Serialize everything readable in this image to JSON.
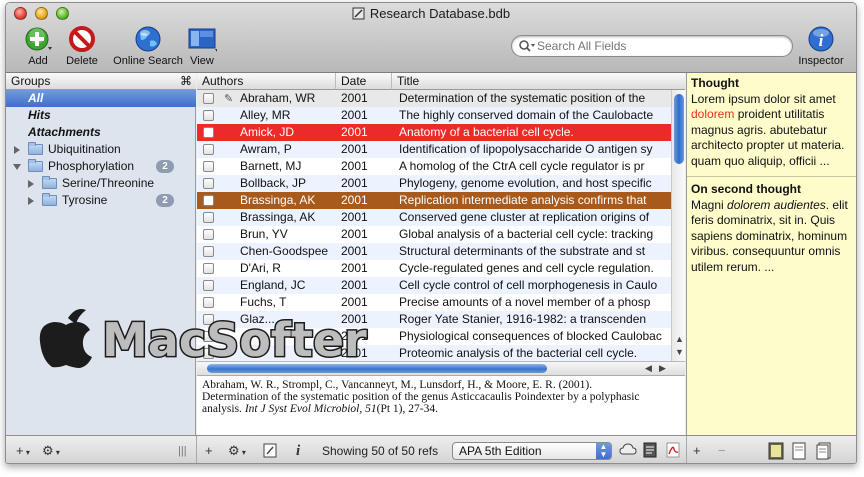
{
  "window": {
    "title": "Research Database.bdb"
  },
  "toolbar": {
    "add_label": "Add",
    "delete_label": "Delete",
    "online_search_label": "Online Search",
    "view_label": "View",
    "inspector_label": "Inspector",
    "search_placeholder": "Search All Fields"
  },
  "groups": {
    "header": "Groups",
    "header_symbol": "⌘",
    "items": [
      {
        "label": "All"
      },
      {
        "label": "Hits"
      },
      {
        "label": "Attachments"
      },
      {
        "label": "Ubiquitination"
      },
      {
        "label": "Phosphorylation",
        "count": "2"
      },
      {
        "label": "Serine/Threonine"
      },
      {
        "label": "Tyrosine",
        "count": "2"
      }
    ]
  },
  "table": {
    "columns": {
      "authors": "Authors",
      "date": "Date",
      "title": "Title"
    },
    "rows": [
      {
        "author": "Abraham, WR",
        "year": "2001",
        "title": "Determination of the systematic position of the"
      },
      {
        "author": "Alley, MR",
        "year": "2001",
        "title": "The highly conserved domain of the Caulobacte"
      },
      {
        "author": "Amick, JD",
        "year": "2001",
        "title": "Anatomy of a bacterial cell cycle."
      },
      {
        "author": "Awram, P",
        "year": "2001",
        "title": "Identification of lipopolysaccharide O antigen sy"
      },
      {
        "author": "Barnett, MJ",
        "year": "2001",
        "title": "A homolog of the CtrA cell cycle regulator is pr"
      },
      {
        "author": "Bollback, JP",
        "year": "2001",
        "title": "Phylogeny, genome evolution, and host specific"
      },
      {
        "author": "Brassinga, AK",
        "year": "2001",
        "title": "Replication intermediate analysis confirms that"
      },
      {
        "author": "Brassinga, AK",
        "year": "2001",
        "title": "Conserved gene cluster at replication origins of"
      },
      {
        "author": "Brun, YV",
        "year": "2001",
        "title": "Global analysis of a bacterial cell cycle: tracking"
      },
      {
        "author": "Chen-Goodspee",
        "year": "2001",
        "title": "Structural determinants of the substrate and st"
      },
      {
        "author": "D'Ari, R",
        "year": "2001",
        "title": "Cycle-regulated genes and cell cycle regulation."
      },
      {
        "author": "England, JC",
        "year": "2001",
        "title": "Cell cycle control of cell morphogenesis in Caulo"
      },
      {
        "author": "Fuchs, T",
        "year": "2001",
        "title": "Precise amounts of a novel member of a phosp"
      },
      {
        "author": "Glaz...",
        "year": "2001",
        "title": "Roger Yate Stanier, 1916-1982: a transcenden"
      },
      {
        "author": "",
        "year": "2001",
        "title": "Physiological consequences of blocked Caulobac"
      },
      {
        "author": "",
        "year": "2001",
        "title": "Proteomic analysis of the bacterial cell cycle."
      }
    ]
  },
  "preview": {
    "line1": "Abraham, W. R., Strompl, C., Vancanneyt, M., Lunsdorf, H., & Moore, E. R. (2001).",
    "line2": "Determination of the systematic position of the genus Asticcacaulis Poindexter by a polyphasic",
    "line3_pre": "analysis. ",
    "journal": "Int J Syst Evol Microbiol, 51",
    "line3_post": "(Pt 1), 27-34."
  },
  "notes": {
    "note1": {
      "title": "Thought",
      "pre": "Lorem ipsum dolor sit amet ",
      "highlight": "dolorem",
      "post": " proident utilitatis magnus agris. abutebatur architecto propter ut materia. quam quo aliquip, officii ..."
    },
    "note2": {
      "title": "On second thought",
      "pre": "Magni ",
      "italic": "dolorem audientes",
      "post": ". elit feris dominatrix, sit in. Quis sapiens dominatrix, hominum viribus. consequuntur omnis utilem rerum. ..."
    }
  },
  "statusbar": {
    "add_symbol": "+",
    "gear_symbol": "⚙",
    "info_symbol": "i",
    "minus_symbol": "−",
    "status_text": "Showing 50 of 50 refs",
    "citation_style": "APA 5th Edition"
  },
  "watermark": {
    "text": "MacSofter"
  },
  "colors": {
    "label_red": "#ec2a2a",
    "label_brown": "#a85a1c",
    "selection_blue": "#3f70c8",
    "notes_bg": "#fefccb"
  }
}
